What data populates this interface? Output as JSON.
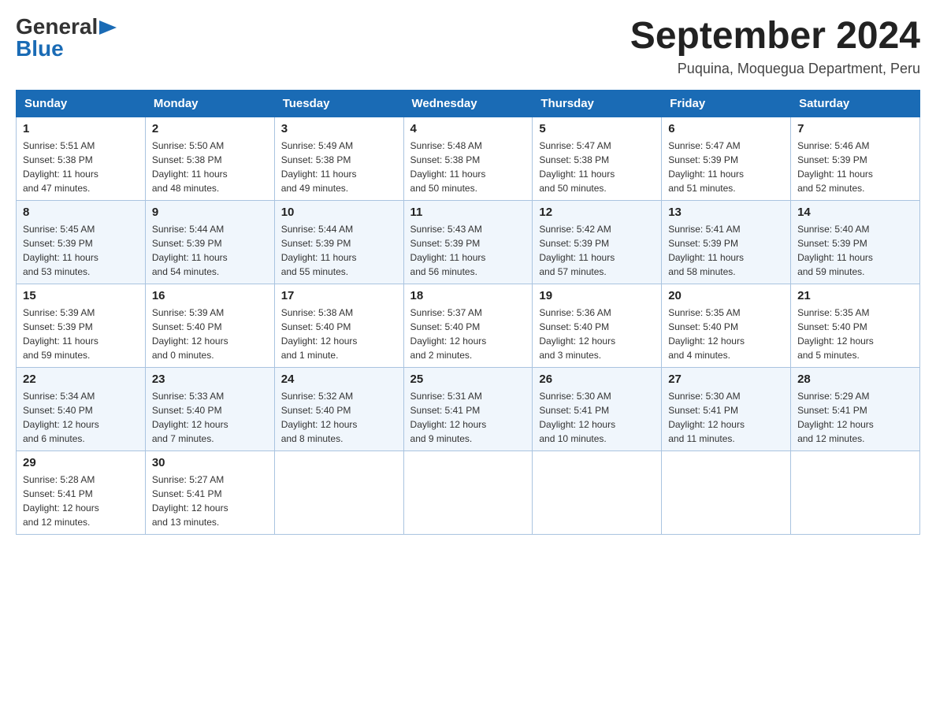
{
  "header": {
    "logo": {
      "general": "General",
      "blue": "Blue",
      "arrow": "▶"
    },
    "title": "September 2024",
    "location": "Puquina, Moquegua Department, Peru"
  },
  "calendar": {
    "days_of_week": [
      "Sunday",
      "Monday",
      "Tuesday",
      "Wednesday",
      "Thursday",
      "Friday",
      "Saturday"
    ],
    "weeks": [
      [
        {
          "day": "1",
          "sunrise": "5:51 AM",
          "sunset": "5:38 PM",
          "daylight": "11 hours and 47 minutes."
        },
        {
          "day": "2",
          "sunrise": "5:50 AM",
          "sunset": "5:38 PM",
          "daylight": "11 hours and 48 minutes."
        },
        {
          "day": "3",
          "sunrise": "5:49 AM",
          "sunset": "5:38 PM",
          "daylight": "11 hours and 49 minutes."
        },
        {
          "day": "4",
          "sunrise": "5:48 AM",
          "sunset": "5:38 PM",
          "daylight": "11 hours and 50 minutes."
        },
        {
          "day": "5",
          "sunrise": "5:47 AM",
          "sunset": "5:38 PM",
          "daylight": "11 hours and 50 minutes."
        },
        {
          "day": "6",
          "sunrise": "5:47 AM",
          "sunset": "5:39 PM",
          "daylight": "11 hours and 51 minutes."
        },
        {
          "day": "7",
          "sunrise": "5:46 AM",
          "sunset": "5:39 PM",
          "daylight": "11 hours and 52 minutes."
        }
      ],
      [
        {
          "day": "8",
          "sunrise": "5:45 AM",
          "sunset": "5:39 PM",
          "daylight": "11 hours and 53 minutes."
        },
        {
          "day": "9",
          "sunrise": "5:44 AM",
          "sunset": "5:39 PM",
          "daylight": "11 hours and 54 minutes."
        },
        {
          "day": "10",
          "sunrise": "5:44 AM",
          "sunset": "5:39 PM",
          "daylight": "11 hours and 55 minutes."
        },
        {
          "day": "11",
          "sunrise": "5:43 AM",
          "sunset": "5:39 PM",
          "daylight": "11 hours and 56 minutes."
        },
        {
          "day": "12",
          "sunrise": "5:42 AM",
          "sunset": "5:39 PM",
          "daylight": "11 hours and 57 minutes."
        },
        {
          "day": "13",
          "sunrise": "5:41 AM",
          "sunset": "5:39 PM",
          "daylight": "11 hours and 58 minutes."
        },
        {
          "day": "14",
          "sunrise": "5:40 AM",
          "sunset": "5:39 PM",
          "daylight": "11 hours and 59 minutes."
        }
      ],
      [
        {
          "day": "15",
          "sunrise": "5:39 AM",
          "sunset": "5:39 PM",
          "daylight": "11 hours and 59 minutes."
        },
        {
          "day": "16",
          "sunrise": "5:39 AM",
          "sunset": "5:40 PM",
          "daylight": "12 hours and 0 minutes."
        },
        {
          "day": "17",
          "sunrise": "5:38 AM",
          "sunset": "5:40 PM",
          "daylight": "12 hours and 1 minute."
        },
        {
          "day": "18",
          "sunrise": "5:37 AM",
          "sunset": "5:40 PM",
          "daylight": "12 hours and 2 minutes."
        },
        {
          "day": "19",
          "sunrise": "5:36 AM",
          "sunset": "5:40 PM",
          "daylight": "12 hours and 3 minutes."
        },
        {
          "day": "20",
          "sunrise": "5:35 AM",
          "sunset": "5:40 PM",
          "daylight": "12 hours and 4 minutes."
        },
        {
          "day": "21",
          "sunrise": "5:35 AM",
          "sunset": "5:40 PM",
          "daylight": "12 hours and 5 minutes."
        }
      ],
      [
        {
          "day": "22",
          "sunrise": "5:34 AM",
          "sunset": "5:40 PM",
          "daylight": "12 hours and 6 minutes."
        },
        {
          "day": "23",
          "sunrise": "5:33 AM",
          "sunset": "5:40 PM",
          "daylight": "12 hours and 7 minutes."
        },
        {
          "day": "24",
          "sunrise": "5:32 AM",
          "sunset": "5:40 PM",
          "daylight": "12 hours and 8 minutes."
        },
        {
          "day": "25",
          "sunrise": "5:31 AM",
          "sunset": "5:41 PM",
          "daylight": "12 hours and 9 minutes."
        },
        {
          "day": "26",
          "sunrise": "5:30 AM",
          "sunset": "5:41 PM",
          "daylight": "12 hours and 10 minutes."
        },
        {
          "day": "27",
          "sunrise": "5:30 AM",
          "sunset": "5:41 PM",
          "daylight": "12 hours and 11 minutes."
        },
        {
          "day": "28",
          "sunrise": "5:29 AM",
          "sunset": "5:41 PM",
          "daylight": "12 hours and 12 minutes."
        }
      ],
      [
        {
          "day": "29",
          "sunrise": "5:28 AM",
          "sunset": "5:41 PM",
          "daylight": "12 hours and 12 minutes."
        },
        {
          "day": "30",
          "sunrise": "5:27 AM",
          "sunset": "5:41 PM",
          "daylight": "12 hours and 13 minutes."
        },
        null,
        null,
        null,
        null,
        null
      ]
    ],
    "labels": {
      "sunrise": "Sunrise:",
      "sunset": "Sunset:",
      "daylight": "Daylight:"
    }
  }
}
